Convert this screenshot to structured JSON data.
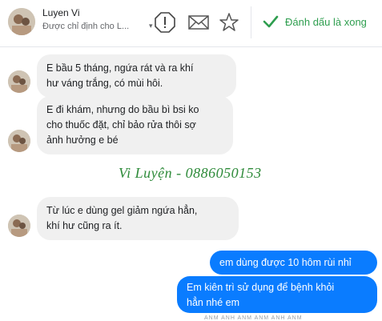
{
  "header": {
    "contact_name": "Luyen Vi",
    "assigned_text": "Được chỉ định cho L...",
    "done_label": "Đánh dấu là xong",
    "accent_color": "#2e9e4f",
    "icons": [
      "alert-icon",
      "mail-icon",
      "star-icon",
      "checkmark-icon",
      "caret-down-icon"
    ]
  },
  "messages": {
    "incoming": [
      {
        "lines": [
          "E bầu 5 tháng, ngứa rát và ra khí",
          "hư váng trắng, có mùi hôi."
        ]
      },
      {
        "lines": [
          "E đi khám, nhưng do bầu bì bsi ko",
          "cho thuốc đặt, chỉ bảo rửa thôi sợ",
          "ảnh hưởng e bé"
        ]
      },
      {
        "lines": [
          "Từ lúc e dùng gel giảm ngứa hẳn,",
          "khí hư cũng ra ít."
        ]
      }
    ],
    "outgoing": [
      {
        "lines": [
          "em dùng được 10 hôm rùi nhỉ"
        ]
      },
      {
        "lines": [
          "Em kiên trì sử dụng để bệnh khỏi",
          "hẳn nhé em"
        ]
      }
    ],
    "outgoing_color": "#0a7cff"
  },
  "watermark": "Vi Luyện - 0886050153",
  "footer_mark": "",
  "bottom_text": "ANM ANH ANM ANM ANH ANM"
}
